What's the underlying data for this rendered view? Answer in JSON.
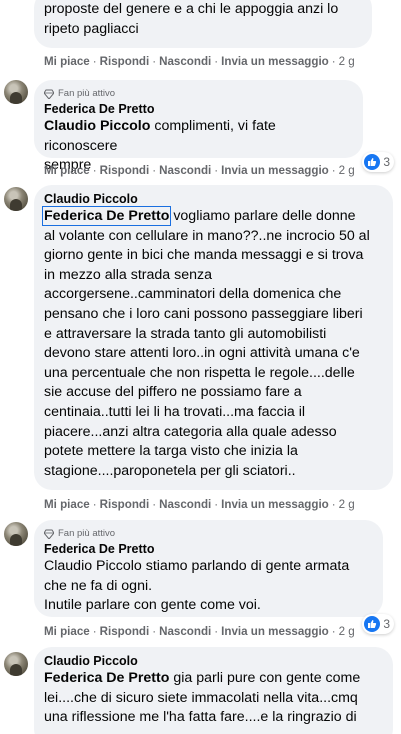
{
  "top_comment": {
    "lines": [
      "proposte del genere e a chi le appoggia anzi lo",
      "ripeto pagliacci"
    ],
    "actions": {
      "like": "Mi piace",
      "reply": "Rispondi",
      "hide": "Nascondi",
      "message": "Invia un messaggio",
      "time": "2 g"
    }
  },
  "comment_1": {
    "badge": "Fan più attivo",
    "author": "Federica De Pretto",
    "mention": "Claudio Piccolo",
    "lines": [
      " complimenti, vi fate riconoscere",
      "sempre"
    ],
    "actions": {
      "like": "Mi piace",
      "reply": "Rispondi",
      "hide": "Nascondi",
      "message": "Invia un messaggio",
      "time": "2 g"
    },
    "reaction_count": "3"
  },
  "comment_2": {
    "author": "Claudio Piccolo",
    "mention": "Federica De Pretto",
    "lines": [
      " vogliamo parlare delle donne",
      "al volante con cellulare in mano??..ne incrocio 50 al",
      "giorno gente in bici che manda messaggi e si trova",
      "in mezzo alla strada senza",
      "accorgersene..camminatori della domenica che",
      "pensano che i loro cani possono passeggiare liberi",
      "e attraversare la strada tanto gli automobilisti",
      "devono stare attenti loro..in ogni attività umana c'e",
      "una percentuale che non rispetta le regole....delle",
      "sie accuse del piffero ne possiamo fare a",
      "centinaia..tutti lei li ha trovati...ma faccia il",
      "piacere...anzi altra categoria alla quale adesso",
      "potete mettere la targa visto che inizia la",
      "stagione....paroponetela per gli sciatori.."
    ],
    "actions": {
      "like": "Mi piace",
      "reply": "Rispondi",
      "hide": "Nascondi",
      "message": "Invia un messaggio",
      "time": "2 g"
    }
  },
  "comment_3": {
    "badge": "Fan più attivo",
    "author": "Federica De Pretto",
    "mention": "Claudio Piccolo",
    "lines": [
      " stiamo parlando di gente armata",
      "che ne fa di ogni.",
      "Inutile parlare con gente come voi."
    ],
    "actions": {
      "like": "Mi piace",
      "reply": "Rispondi",
      "hide": "Nascondi",
      "message": "Invia un messaggio",
      "time": "2 g"
    },
    "reaction_count": "3"
  },
  "comment_4": {
    "author": "Claudio Piccolo",
    "mention": "Federica De Pretto",
    "lines": [
      " gia parli pure con gente come",
      "lei....che di sicuro siete immacolati nella vita...cmq",
      "una riflessione me l'ha fatta fare....e la ringrazio di"
    ]
  },
  "colors": {
    "bubble": "#f0f2f5",
    "secondary_text": "#65676b",
    "like_blue": "#1877f2",
    "mention_outline": "#1a6fe0"
  }
}
